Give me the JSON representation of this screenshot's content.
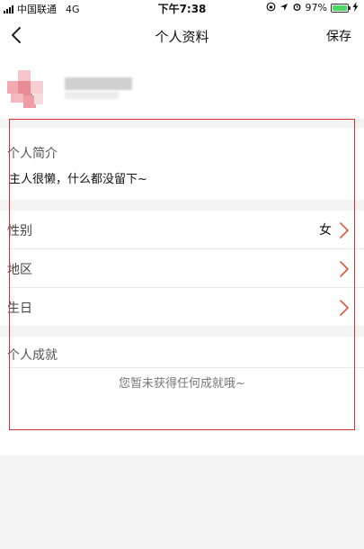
{
  "status_bar": {
    "carrier": "中国联通",
    "network": "4G",
    "time": "下午7:38",
    "battery": "97%",
    "battery_level": 0.97,
    "icons": [
      "signal-icon",
      "lock-rotation-icon",
      "location-icon",
      "alarm-icon",
      "battery-icon",
      "charging-icon"
    ]
  },
  "nav": {
    "back_icon": "chevron-left-icon",
    "title": "个人资料",
    "save_label": "保存"
  },
  "profile": {
    "avatar_icon": "avatar-icon"
  },
  "bio": {
    "title": "个人简介",
    "text": "主人很懒，什么都没留下~"
  },
  "fields": [
    {
      "label": "性别",
      "value": "女"
    },
    {
      "label": "地区",
      "value": ""
    },
    {
      "label": "生日",
      "value": ""
    }
  ],
  "achievements": {
    "title": "个人成就",
    "empty_text": "您暂未获得任何成就哦~"
  },
  "colors": {
    "accent": "#e2533c",
    "highlight_border": "#d9302c",
    "battery_green": "#4cd964"
  }
}
